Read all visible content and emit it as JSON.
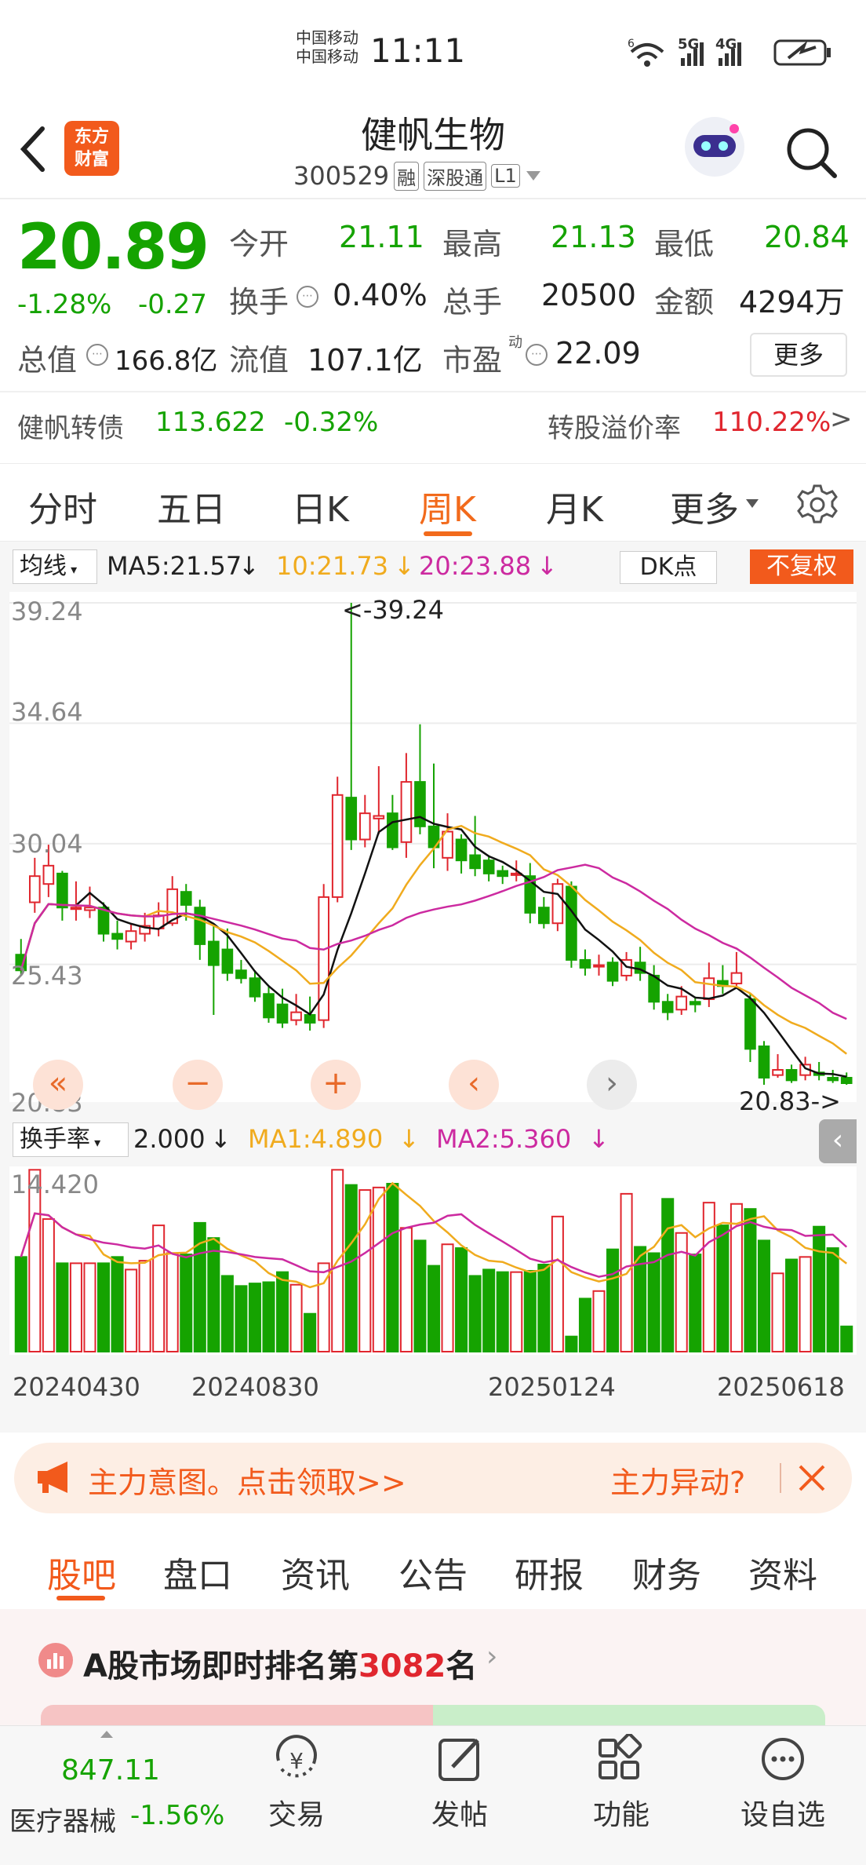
{
  "status": {
    "carrier1": "中国移动",
    "carrier2": "中国移动",
    "time": "11:11",
    "net1": "6",
    "net2": "5G",
    "net3": "4G"
  },
  "header": {
    "title": "健帆生物",
    "code": "300529",
    "tag1": "融",
    "tag2": "深股通",
    "tag3": "L1",
    "logo_line1": "东方",
    "logo_line2": "财富"
  },
  "quote": {
    "price": "20.89",
    "pct": "-1.28%",
    "chg": "-0.27",
    "open_label": "今开",
    "open": "21.11",
    "high_label": "最高",
    "high": "21.13",
    "low_label": "最低",
    "low": "20.84",
    "turn_label": "换手",
    "turn": "0.40%",
    "vol_label": "总手",
    "vol": "20500",
    "amt_label": "金额",
    "amt": "4294万",
    "mcap_label": "总值",
    "mcap": "166.8亿",
    "float_label": "流值",
    "float": "107.1亿",
    "pe_label": "市盈",
    "pe_sup": "动",
    "pe": "22.09",
    "more": "更多",
    "bond_name": "健帆转债",
    "bond_price": "113.622",
    "bond_pct": "-0.32%",
    "premium_label": "转股溢价率",
    "premium": "110.22%"
  },
  "tabs": {
    "t1": "分时",
    "t2": "五日",
    "t3": "日K",
    "t4": "周K",
    "t5": "月K",
    "t6": "更多"
  },
  "chart": {
    "ma_sel": "均线",
    "ma5": "MA5:21.57",
    "ma10": "10:21.73",
    "ma20": "20:23.88",
    "dk": "DK点",
    "fq": "不复权",
    "y1": "39.24",
    "y2": "34.64",
    "y3": "30.04",
    "y4": "25.43",
    "y5": "20.83",
    "max_label": "<-39.24",
    "min_label": "20.83->",
    "ind_sel": "换手率",
    "ind_val": "2.000",
    "ind_ma1": "MA1:4.890",
    "ind_ma2": "MA2:5.360",
    "ind_top": "14.420",
    "d1": "20240430",
    "d2": "20240830",
    "d3": "20250124",
    "d4": "20250618"
  },
  "chart_data": {
    "type": "candlestick",
    "ylim": [
      20.83,
      39.24
    ],
    "ohlc": [
      [
        25.8,
        25.2,
        26.4,
        25.0
      ],
      [
        27.8,
        28.8,
        29.5,
        27.4
      ],
      [
        28.5,
        29.2,
        30.0,
        28.0
      ],
      [
        28.9,
        27.6,
        29.0,
        27.1
      ],
      [
        27.6,
        27.6,
        28.6,
        27.1
      ],
      [
        27.5,
        27.6,
        28.4,
        27.2
      ],
      [
        27.6,
        26.6,
        27.8,
        26.3
      ],
      [
        26.6,
        26.4,
        27.1,
        26.0
      ],
      [
        26.3,
        26.7,
        27.0,
        26.0
      ],
      [
        26.6,
        26.9,
        27.4,
        26.3
      ],
      [
        26.8,
        27.3,
        27.8,
        26.5
      ],
      [
        27.0,
        28.3,
        28.8,
        26.9
      ],
      [
        28.2,
        27.7,
        28.5,
        27.1
      ],
      [
        27.6,
        26.2,
        27.9,
        25.6
      ],
      [
        26.3,
        25.4,
        26.9,
        23.5
      ],
      [
        26.0,
        25.1,
        26.8,
        24.8
      ],
      [
        25.2,
        24.9,
        25.6,
        24.7
      ],
      [
        24.9,
        24.2,
        25.2,
        24.0
      ],
      [
        24.3,
        23.4,
        24.6,
        23.2
      ],
      [
        23.9,
        23.2,
        24.5,
        23.0
      ],
      [
        23.3,
        23.6,
        24.3,
        23.1
      ],
      [
        23.5,
        23.2,
        24.2,
        22.9
      ],
      [
        23.3,
        28.0,
        28.5,
        23.0
      ],
      [
        28.0,
        31.9,
        32.6,
        27.8
      ],
      [
        31.8,
        30.2,
        39.24,
        29.8
      ],
      [
        30.2,
        31.2,
        31.9,
        29.9
      ],
      [
        31.0,
        31.1,
        33.0,
        30.4
      ],
      [
        31.2,
        29.9,
        31.9,
        29.8
      ],
      [
        30.1,
        32.4,
        33.5,
        29.5
      ],
      [
        32.4,
        30.7,
        34.6,
        30.4
      ],
      [
        30.7,
        29.9,
        33.1,
        29.1
      ],
      [
        29.5,
        30.5,
        31.2,
        29.0
      ],
      [
        30.2,
        29.4,
        30.4,
        28.9
      ],
      [
        29.6,
        29.1,
        31.1,
        28.8
      ],
      [
        29.4,
        28.9,
        29.6,
        28.6
      ],
      [
        29.0,
        28.8,
        29.2,
        28.5
      ],
      [
        28.9,
        28.9,
        29.4,
        28.6
      ],
      [
        28.8,
        27.4,
        29.3,
        27.0
      ],
      [
        27.6,
        27.0,
        28.0,
        26.8
      ],
      [
        27.0,
        28.5,
        28.7,
        26.7
      ],
      [
        28.4,
        25.6,
        28.6,
        25.3
      ],
      [
        25.6,
        25.3,
        26.0,
        25.0
      ],
      [
        25.4,
        25.4,
        25.8,
        25.0
      ],
      [
        25.5,
        24.8,
        25.7,
        24.6
      ],
      [
        25.0,
        25.6,
        25.9,
        24.8
      ],
      [
        25.5,
        25.1,
        26.1,
        24.8
      ],
      [
        25.0,
        24.0,
        25.4,
        23.7
      ],
      [
        24.0,
        23.6,
        24.3,
        23.3
      ],
      [
        23.7,
        24.2,
        24.6,
        23.5
      ],
      [
        24.0,
        23.9,
        24.2,
        23.6
      ],
      [
        24.1,
        24.9,
        25.5,
        23.8
      ],
      [
        24.8,
        24.6,
        25.4,
        24.3
      ],
      [
        24.7,
        25.1,
        25.9,
        24.5
      ],
      [
        24.1,
        22.2,
        24.3,
        21.7
      ],
      [
        22.3,
        21.1,
        22.5,
        20.83
      ],
      [
        21.2,
        21.4,
        22.0,
        21.1
      ],
      [
        21.4,
        21.0,
        21.6,
        20.9
      ],
      [
        21.2,
        21.6,
        21.9,
        21.0
      ],
      [
        21.3,
        21.2,
        21.7,
        21.0
      ],
      [
        21.1,
        21.0,
        21.4,
        20.9
      ],
      [
        21.1,
        20.89,
        21.3,
        20.83
      ]
    ],
    "volume": [
      7.5,
      14.4,
      10.5,
      7.0,
      7.0,
      7.0,
      7.0,
      7.5,
      6.5,
      7.2,
      10.0,
      7.8,
      7.7,
      10.2,
      9.0,
      6.0,
      5.2,
      5.4,
      5.5,
      6.3,
      5.3,
      3.0,
      7.0,
      14.4,
      13.2,
      12.8,
      13.0,
      13.3,
      9.8,
      8.8,
      6.8,
      8.5,
      8.2,
      6.0,
      6.5,
      6.3,
      6.3,
      6.4,
      6.9,
      10.7,
      1.2,
      4.2,
      4.8,
      8.1,
      12.5,
      8.3,
      7.8,
      12.1,
      9.4,
      7.7,
      11.8,
      10.0,
      11.7,
      11.3,
      8.8,
      6.2,
      7.3,
      7.5,
      9.9,
      8.2,
      2.0
    ]
  },
  "banner": {
    "text": "主力意图。点击领取>>",
    "right": "主力异动?"
  },
  "subtabs": {
    "s1": "股吧",
    "s2": "盘口",
    "s3": "资讯",
    "s4": "公告",
    "s5": "研报",
    "s6": "财务",
    "s7": "资料"
  },
  "rank": {
    "pre": "A股市场即时排名第",
    "num": "3082",
    "post": "名"
  },
  "bottom": {
    "index": "847.11",
    "sector": "医疗器械",
    "sector_pct": "-1.56%",
    "n1": "交易",
    "n2": "发帖",
    "n3": "功能",
    "n4": "设自选"
  }
}
